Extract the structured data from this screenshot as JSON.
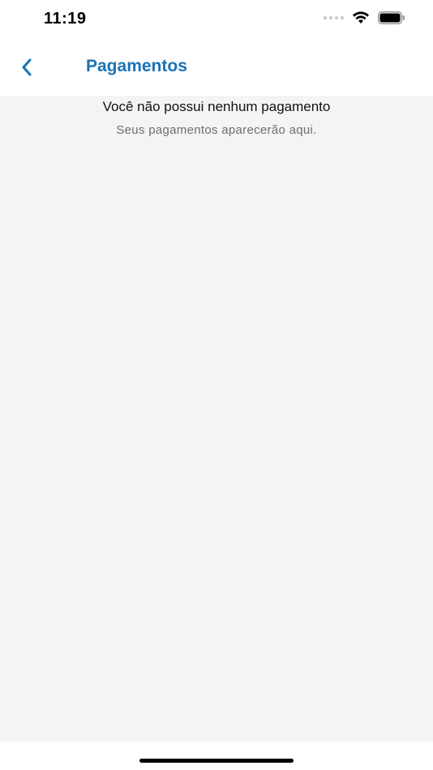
{
  "status_bar": {
    "time": "11:19"
  },
  "nav": {
    "title": "Pagamentos",
    "accent_color": "#1a73b4",
    "back_icon": "chevron-left-icon"
  },
  "empty_state": {
    "title": "Você não possui nenhum pagamento",
    "subtitle": "Seus pagamentos aparecerão aqui."
  }
}
